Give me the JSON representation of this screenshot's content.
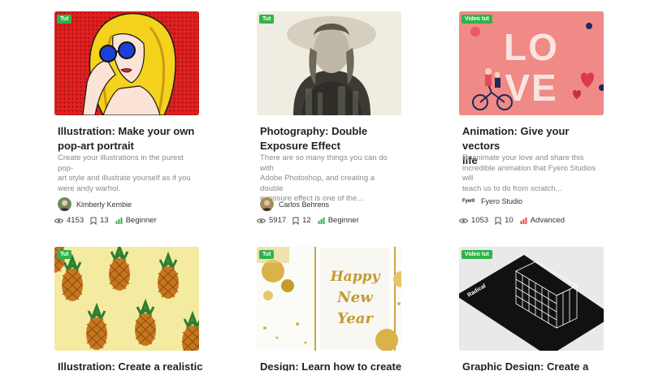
{
  "cards": [
    {
      "badge": "Tut",
      "title_line1": "Illustration: Make your own",
      "title_line2": "pop-art portrait",
      "desc_line1": "Create your illustrations in the purest pop-",
      "desc_line2": "art style and illustrate yourself as if you",
      "desc_line3": "were andy warhol.",
      "author": "Kimberly Kembie",
      "views": "4153",
      "saves": "13",
      "level": "Beginner",
      "level_color": "#2fb34a"
    },
    {
      "badge": "Tut",
      "title_line1": "Photography: Double",
      "title_line2": "Exposure Effect",
      "desc_line1": "There are so many things you can do with",
      "desc_line2": "Adobe Photoshop, and creating a double",
      "desc_line3": "exposure effect is one of the...",
      "author": "Carlos Behrens",
      "views": "5917",
      "saves": "12",
      "level": "Beginner",
      "level_color": "#2fb34a"
    },
    {
      "badge": "Video tut",
      "title_line1": "Animation: Give your vectors",
      "title_line2": "life",
      "desc_line1": "Reanimate your love and share this",
      "desc_line2": "incredible animation that Fyero Studios will",
      "desc_line3": "teach us to do from scratch...",
      "author": "Fyero Studio",
      "author_logo": "Fyer0",
      "views": "1053",
      "saves": "10",
      "level": "Advanced",
      "level_color": "#e2493b",
      "thumb_text": "LOVE"
    },
    {
      "badge": "Tut",
      "title_line1": "Illustration: Create a realistic"
    },
    {
      "badge": "Tut",
      "title_line1": "Design: Learn how to create a",
      "thumb_text_1": "Happy",
      "thumb_text_2": "New",
      "thumb_text_3": "Year"
    },
    {
      "badge": "Video tut",
      "title_line1": "Graphic Design: Create a",
      "thumb_text": "Radical"
    }
  ],
  "icons": {
    "views": "eye-icon",
    "saves": "bookmark-icon",
    "level": "level-bars-icon"
  }
}
